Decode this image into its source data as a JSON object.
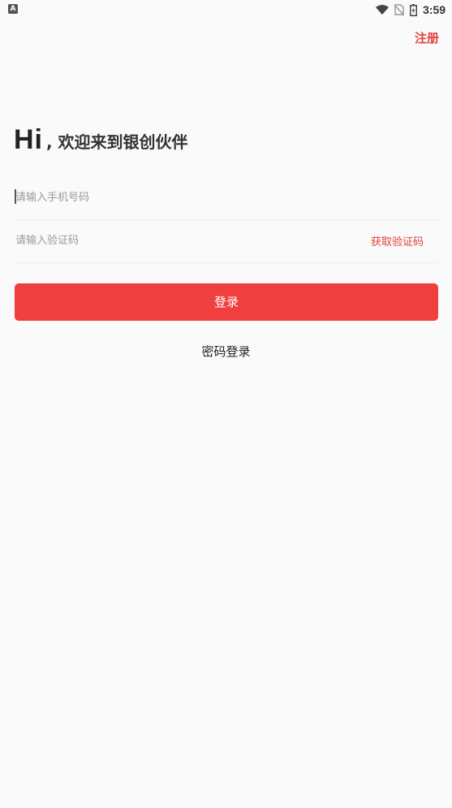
{
  "status_bar": {
    "left_icon": "A",
    "time": "3:59",
    "icons": [
      "wifi-icon",
      "no-sim-icon",
      "battery-icon"
    ]
  },
  "header": {
    "register_label": "注册"
  },
  "greeting": {
    "hi": "Hi",
    "text": ", 欢迎来到银创伙伴"
  },
  "form": {
    "phone_placeholder": "请输入手机号码",
    "phone_value": "",
    "code_placeholder": "请输入验证码",
    "code_value": "",
    "get_code_label": "获取验证码",
    "login_label": "登录",
    "password_login_label": "密码登录"
  },
  "colors": {
    "accent": "#ef3f3f",
    "link": "#e2403e",
    "background": "#fafafa"
  }
}
